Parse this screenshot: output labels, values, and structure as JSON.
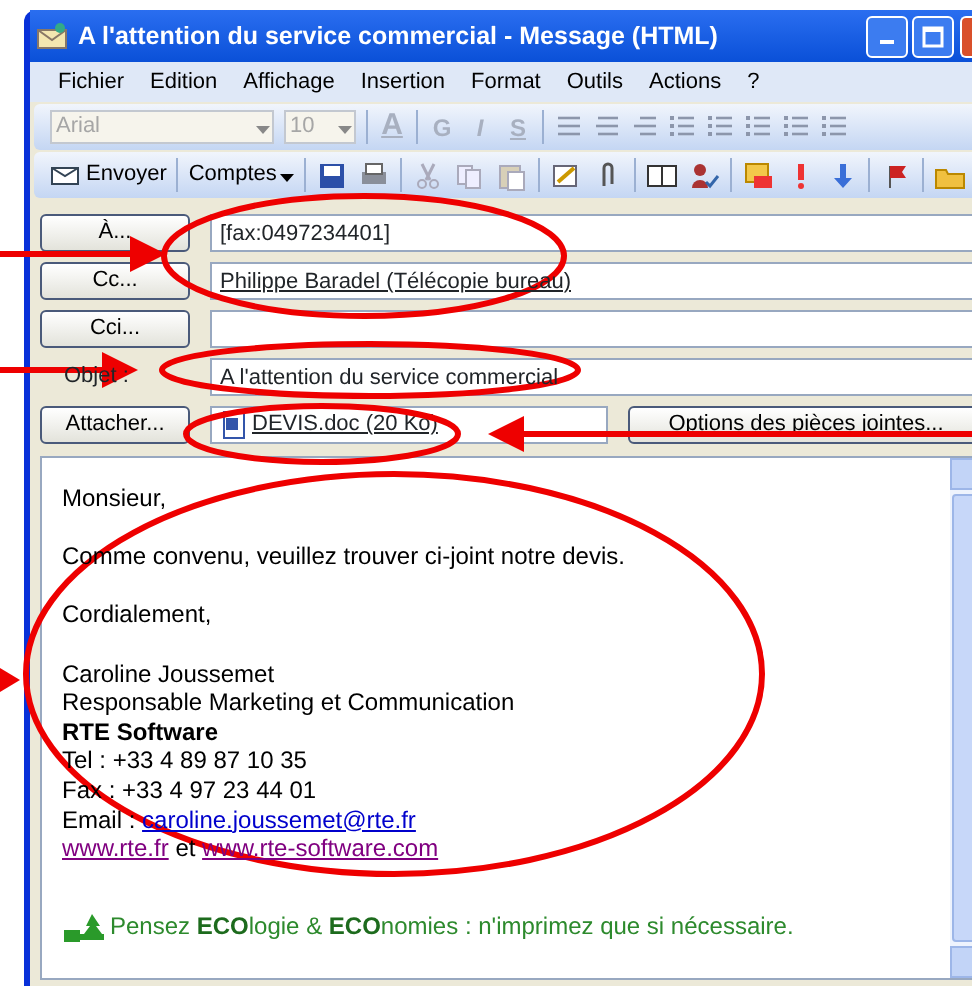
{
  "window": {
    "title": "A l'attention du service commercial - Message (HTML)"
  },
  "menu": [
    "Fichier",
    "Edition",
    "Affichage",
    "Insertion",
    "Format",
    "Outils",
    "Actions",
    "?"
  ],
  "format_toolbar": {
    "font": "Arial",
    "size": "10",
    "disabled": true,
    "buttons": [
      "A",
      "G",
      "I",
      "S"
    ]
  },
  "standard_toolbar": {
    "send": "Envoyer",
    "accounts": "Comptes"
  },
  "header": {
    "fields": [
      {
        "label": "À...",
        "kind": "button",
        "value": "[fax:0497234401]",
        "resolved": false
      },
      {
        "label": "Cc...",
        "kind": "button",
        "value": "Philippe Baradel (Télécopie bureau)",
        "resolved": true
      },
      {
        "label": "Cci...",
        "kind": "button"
      },
      {
        "label": "Objet :",
        "kind": "label",
        "value": "A l'attention du service commercial",
        "resolved": false
      }
    ],
    "attach_button": "Attacher...",
    "attachment": "DEVIS.doc (20 Ko)",
    "options_button": "Options des pièces jointes..."
  },
  "body": {
    "paragraphs": [
      "Monsieur,",
      "Comme convenu, veuillez trouver ci-joint notre devis.",
      "Cordialement,"
    ],
    "signature": [
      {
        "kind": "text",
        "text": "Caroline Joussemet"
      },
      {
        "kind": "text",
        "text": "Responsable Marketing et Communication"
      },
      {
        "kind": "bold",
        "text": "RTE Software"
      },
      {
        "kind": "text",
        "text": "Tel : +33 4 89 87 10 35"
      },
      {
        "kind": "text",
        "text": "Fax : +33 4 97 23 44 01"
      },
      {
        "kind": "email",
        "label": "Email :",
        "link": "caroline.joussemet@rte.fr"
      },
      {
        "kind": "sites",
        "links": [
          "www.rte.fr",
          "www.rte-software.com"
        ],
        "joiner": "et"
      }
    ],
    "eco_note": "Pensez **ECO**logie & **ECO**nomies : n'imprimez que si nécessaire."
  }
}
